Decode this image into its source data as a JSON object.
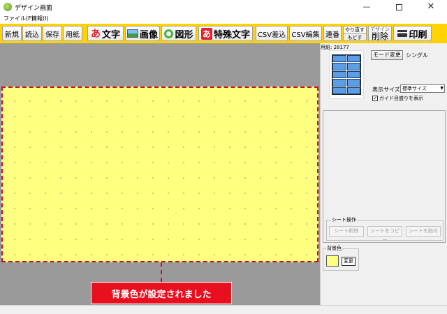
{
  "window": {
    "title": "デザイン画面",
    "minimize": "—",
    "close": "✕"
  },
  "menu": [
    {
      "label": "ファイル(F)"
    },
    {
      "label": "情報(I)"
    }
  ],
  "toolbar": {
    "new": "新規",
    "load": "読込",
    "save": "保存",
    "paper": "用紙",
    "text_icon": "あ",
    "text": "文字",
    "image": "画像",
    "shape": "図形",
    "special_icon": "あ",
    "special_text": "特殊文字",
    "csv_insert": "CSV差込",
    "csv_edit": "CSV編集",
    "serial": "連番",
    "redo": "やり直す",
    "undo": "もどす",
    "design_top": "デザイン",
    "design_delete": "削除",
    "print": "印刷",
    "accent": "#ffd200"
  },
  "canvas": {
    "background": "#ffff80",
    "message": "背景色が設定されました"
  },
  "panel": {
    "paper_label": "用紙: 28177",
    "mode_button": "モード変更",
    "mode_value": "シングル",
    "size_label": "表示サイズ",
    "size_value": "標準サイズ",
    "guide_label": "ガイド目盛りを表示",
    "guide_checked": true,
    "sheet_ops_label": "シート操作",
    "sheet_delete": "シート削除",
    "sheet_copy": "シートをコピー",
    "sheet_paste": "シートを貼付",
    "bg_label": "背景色",
    "bg_change": "変更",
    "bg_color": "#ffff80"
  }
}
